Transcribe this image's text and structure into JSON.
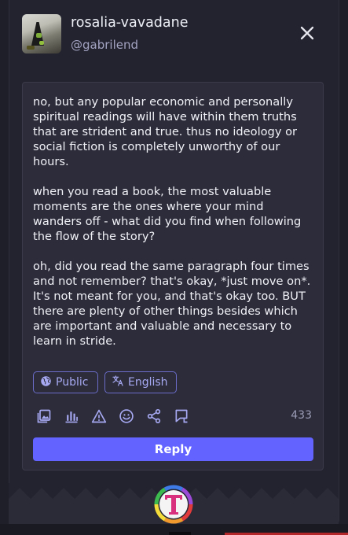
{
  "profile": {
    "display_name": "rosalia-vavadane",
    "handle": "@gabrilend",
    "avatar_icon": "profile-photo"
  },
  "compose": {
    "text": "no, but any popular economic and personally spiritual readings will have within them truths that are strident and true. thus no ideology or social fiction is completely unworthy of our hours.\n\nwhen you read a book, the most valuable moments are the ones where your mind wanders off - what did you find when following the flow of the story?\n\noh, did you read the same paragraph four times and not remember? that's okay, *just move on*. It's not meant for you, and that's okay too. BUT there are plenty of other things besides which are important and valuable and necessary to learn in stride.",
    "visibility_label": "Public",
    "language_label": "English",
    "char_count": "433",
    "reply_label": "Reply"
  },
  "toolbar_icons": [
    "image-icon",
    "poll-icon",
    "warning-icon",
    "emoji-icon",
    "share-icon",
    "quote-icon"
  ],
  "colors": {
    "accent": "#6364ff",
    "chip_text": "#a7a9f2",
    "background": "#1f1f2a"
  }
}
